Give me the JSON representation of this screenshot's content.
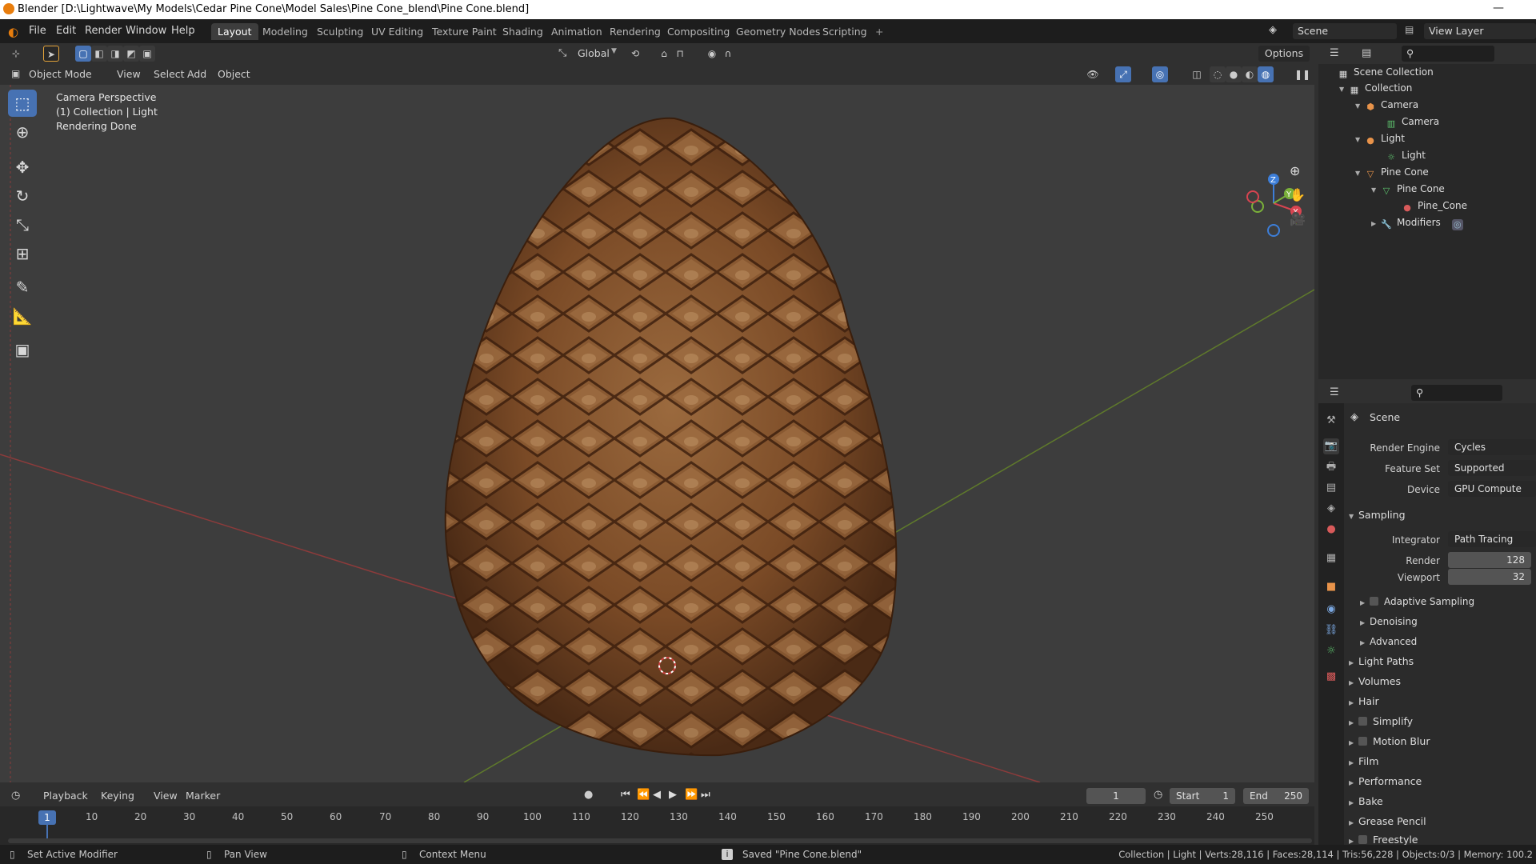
{
  "window": {
    "title": "Blender [D:\\Lightwave\\My Models\\Cedar Pine Cone\\Model Sales\\Pine Cone_blend\\Pine Cone.blend]",
    "minimize": "—",
    "close": "✕"
  },
  "menu": [
    "File",
    "Edit",
    "Render",
    "Window",
    "Help"
  ],
  "workspaces": {
    "tabs": [
      "Layout",
      "Modeling",
      "Sculpting",
      "UV Editing",
      "Texture Paint",
      "Shading",
      "Animation",
      "Rendering",
      "Compositing",
      "Geometry Nodes",
      "Scripting"
    ],
    "active": "Layout",
    "add": "+"
  },
  "scene_selector": {
    "value": "Scene"
  },
  "view_layer_selector": {
    "value": "View Layer"
  },
  "viewport_header": {
    "transform_orientation": "Global",
    "options": "Options",
    "mode": "Object Mode",
    "menus": [
      "View",
      "Select",
      "Add",
      "Object"
    ]
  },
  "viewport": {
    "overlay_lines": [
      "Camera Perspective",
      "(1) Collection | Light",
      "Rendering Done"
    ],
    "gizmo_axes": {
      "z": "Z",
      "y": "Y",
      "x": "X"
    }
  },
  "toolbar": {
    "tools": [
      {
        "name": "select-box",
        "icon": "⬚",
        "active": true
      },
      {
        "name": "cursor",
        "icon": "⊕",
        "active": false
      },
      {
        "name": "move",
        "icon": "✥",
        "active": false
      },
      {
        "name": "rotate",
        "icon": "↻",
        "active": false
      },
      {
        "name": "scale",
        "icon": "⤡",
        "active": false
      },
      {
        "name": "transform",
        "icon": "⊞",
        "active": false
      },
      {
        "name": "annotate",
        "icon": "✎",
        "active": false
      },
      {
        "name": "measure",
        "icon": "📐",
        "active": false
      },
      {
        "name": "add-cube",
        "icon": "▣",
        "active": false
      }
    ]
  },
  "outliner": {
    "rows": [
      {
        "label": "Scene Collection",
        "icon": "▦",
        "color": "#cccccc",
        "expand": ""
      },
      {
        "label": "Collection",
        "icon": "▦",
        "color": "#cccccc",
        "expand": "▼"
      },
      {
        "label": "Camera",
        "icon": "📷",
        "color": "#e8934a",
        "expand": "▼"
      },
      {
        "label": "Camera",
        "icon": "▥",
        "color": "#5ec46e",
        "expand": ""
      },
      {
        "label": "Light",
        "icon": "●",
        "color": "#e8934a",
        "expand": "▼"
      },
      {
        "label": "Light",
        "icon": "☼",
        "color": "#5ec46e",
        "expand": ""
      },
      {
        "label": "Pine Cone",
        "icon": "▽",
        "color": "#e8934a",
        "expand": "▼"
      },
      {
        "label": "Pine Cone",
        "icon": "▽",
        "color": "#5ec46e",
        "expand": "▼"
      },
      {
        "label": "Pine_Cone",
        "icon": "●",
        "color": "#d85a5a",
        "expand": ""
      },
      {
        "label": "Modifiers",
        "icon": "🔧",
        "color": "#7aa7e0",
        "expand": "▶"
      }
    ]
  },
  "properties": {
    "context": "Scene",
    "render_engine": {
      "label": "Render Engine",
      "value": "Cycles"
    },
    "feature_set": {
      "label": "Feature Set",
      "value": "Supported"
    },
    "device": {
      "label": "Device",
      "value": "GPU Compute"
    },
    "sampling": {
      "label": "Sampling",
      "integrator": {
        "label": "Integrator",
        "value": "Path Tracing"
      },
      "render": {
        "label": "Render",
        "value": "128"
      },
      "viewport": {
        "label": "Viewport",
        "value": "32"
      },
      "subpanels": [
        "Adaptive Sampling",
        "Denoising",
        "Advanced"
      ]
    },
    "sections": [
      {
        "label": "Light Paths",
        "checkbox": false
      },
      {
        "label": "Volumes",
        "checkbox": false
      },
      {
        "label": "Hair",
        "checkbox": false
      },
      {
        "label": "Simplify",
        "checkbox": true
      },
      {
        "label": "Motion Blur",
        "checkbox": true
      },
      {
        "label": "Film",
        "checkbox": false
      },
      {
        "label": "Performance",
        "checkbox": false
      },
      {
        "label": "Bake",
        "checkbox": false
      },
      {
        "label": "Grease Pencil",
        "checkbox": false
      },
      {
        "label": "Freestyle",
        "checkbox": true
      }
    ]
  },
  "timeline": {
    "menus": [
      "Playback",
      "Keying",
      "View",
      "Marker"
    ],
    "current_frame": "1",
    "start_label": "Start",
    "start": "1",
    "end_label": "End",
    "end": "250",
    "ticks": [
      "10",
      "20",
      "30",
      "40",
      "50",
      "60",
      "70",
      "80",
      "90",
      "100",
      "110",
      "120",
      "130",
      "140",
      "150",
      "160",
      "170",
      "180",
      "190",
      "200",
      "210",
      "220",
      "230",
      "240",
      "250"
    ],
    "playhead": "1"
  },
  "statusbar": {
    "left": "Set Active Modifier",
    "middle": "Pan View",
    "context": "Context Menu",
    "message": "Saved \"Pine Cone.blend\"",
    "stats": "Collection | Light | Verts:28,116 | Faces:28,114 | Tris:56,228 | Objects:0/3 | Memory: 100.2"
  }
}
